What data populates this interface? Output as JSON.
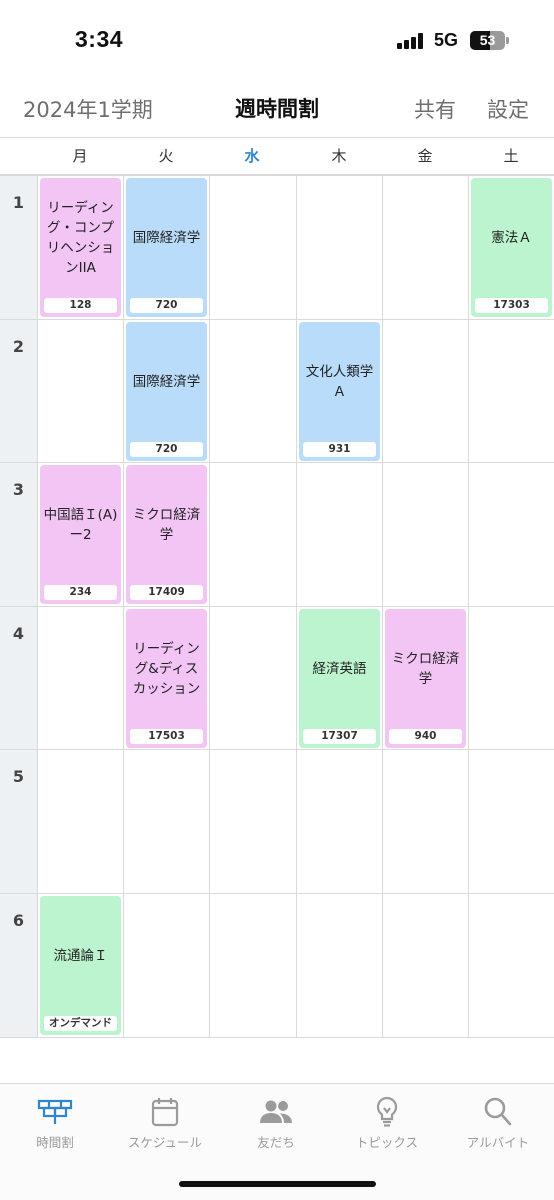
{
  "status": {
    "time": "3:34",
    "network": "5G",
    "battery": "53"
  },
  "nav": {
    "term": "2024年1学期",
    "title": "週時間割",
    "share": "共有",
    "settings": "設定"
  },
  "days": [
    "月",
    "火",
    "水",
    "木",
    "金",
    "土"
  ],
  "today_index": 2,
  "periods": [
    "1",
    "2",
    "3",
    "4",
    "5",
    "6"
  ],
  "courses": [
    {
      "day": 0,
      "period": 0,
      "name": "リーディング・コンプリヘンションIIA",
      "room": "128",
      "color": "pink"
    },
    {
      "day": 1,
      "period": 0,
      "name": "国際経済学",
      "room": "720",
      "color": "blue"
    },
    {
      "day": 5,
      "period": 0,
      "name": "憲法Ａ",
      "room": "17303",
      "color": "green"
    },
    {
      "day": 1,
      "period": 1,
      "name": "国際経済学",
      "room": "720",
      "color": "blue"
    },
    {
      "day": 3,
      "period": 1,
      "name": "文化人類学Ａ",
      "room": "931",
      "color": "blue"
    },
    {
      "day": 0,
      "period": 2,
      "name": "中国語Ｉ(A)ー2",
      "room": "234",
      "color": "pink"
    },
    {
      "day": 1,
      "period": 2,
      "name": "ミクロ経済学",
      "room": "17409",
      "color": "pink"
    },
    {
      "day": 1,
      "period": 3,
      "name": "リーディング&ディスカッション",
      "room": "17503",
      "color": "pink"
    },
    {
      "day": 3,
      "period": 3,
      "name": "経済英語",
      "room": "17307",
      "color": "green"
    },
    {
      "day": 4,
      "period": 3,
      "name": "ミクロ経済学",
      "room": "940",
      "color": "pink"
    },
    {
      "day": 0,
      "period": 5,
      "name": "流通論Ｉ",
      "room": "オンデマンド",
      "color": "green"
    }
  ],
  "colors": {
    "pink": "#f2c5f5",
    "blue": "#b9dcfa",
    "green": "#bdf4d0",
    "accent": "#2e86d1"
  },
  "tabs": [
    {
      "label": "時間割",
      "icon": "timetable-icon",
      "active": true
    },
    {
      "label": "スケジュール",
      "icon": "calendar-icon",
      "active": false
    },
    {
      "label": "友だち",
      "icon": "friends-icon",
      "active": false
    },
    {
      "label": "トピックス",
      "icon": "lightbulb-icon",
      "active": false
    },
    {
      "label": "アルバイト",
      "icon": "search-icon",
      "active": false
    }
  ]
}
